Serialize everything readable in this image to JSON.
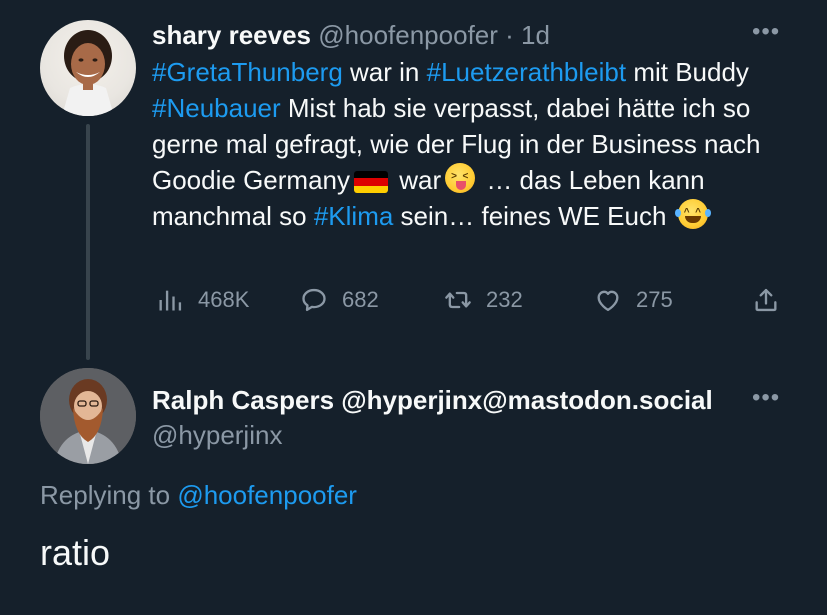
{
  "original_tweet": {
    "display_name": "shary reeves",
    "handle": "@hoofenpoofer",
    "separator": "·",
    "time": "1d",
    "more_label": "•••",
    "text": {
      "t1_tag": "#GretaThunberg",
      "t1_a": " war in ",
      "t1_tag2": "#Luetzerathbleibt",
      "t1_b": " mit Buddy ",
      "t1_tag3": "#Neubauer",
      "t1_c": " Mist hab sie verpasst, dabei hätte ich so gerne mal gefragt, wie der Flug in der Business nach Goodie Germany",
      "t1_d": " war",
      "t1_e": " … das Leben kann manchmal so ",
      "t1_tag4": "#Klima",
      "t1_f": " sein… feines WE Euch"
    },
    "emojis": {
      "flag": "germany-flag",
      "face1": "squinting-face-with-tongue",
      "face2": "face-with-tears-of-joy"
    },
    "stats": {
      "views": "468K",
      "replies": "682",
      "retweets": "232",
      "likes": "275"
    }
  },
  "reply_tweet": {
    "display_name": "Ralph Caspers @hyperjinx@mastodon.social",
    "handle": "@hyperjinx",
    "more_label": "•••",
    "replying_prefix": "Replying to ",
    "replying_to": "@hoofenpoofer",
    "text": "ratio"
  },
  "colors": {
    "background": "#15202b",
    "accent": "#1d9bf0",
    "muted": "#8b98a5",
    "text": "#f7f9f9"
  }
}
